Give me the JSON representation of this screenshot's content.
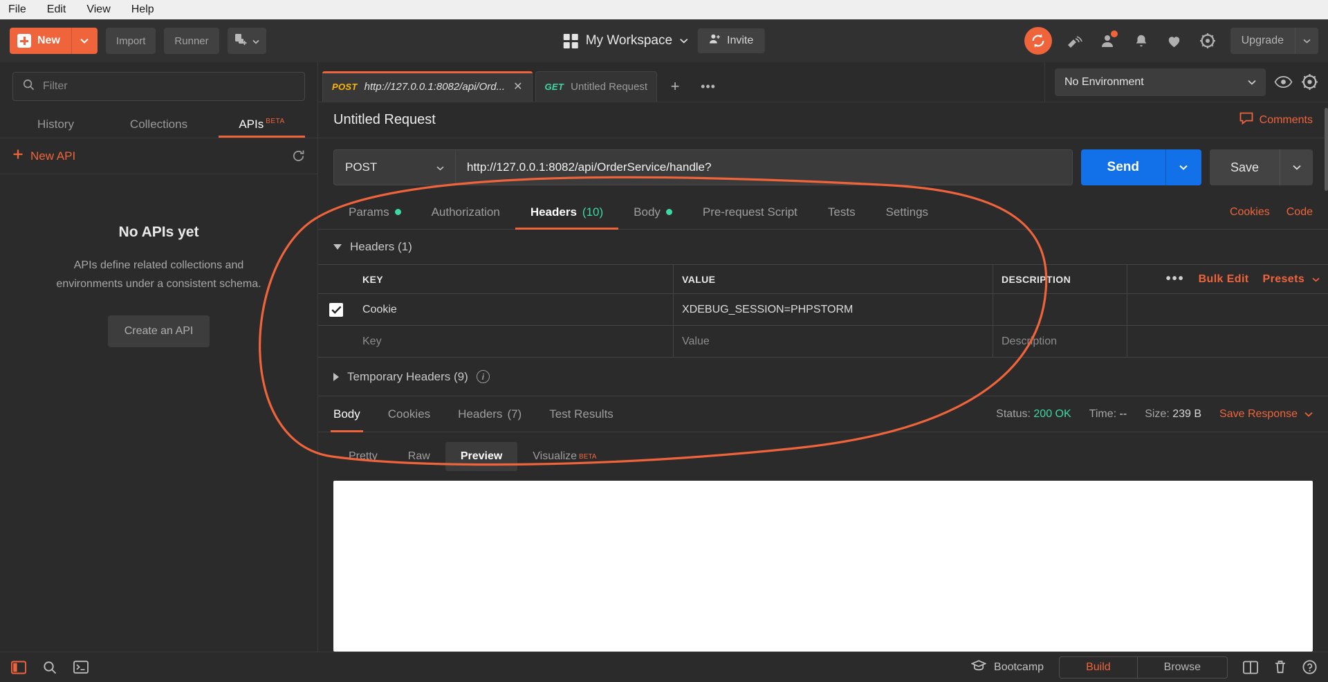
{
  "menubar": {
    "items": [
      "File",
      "Edit",
      "View",
      "Help"
    ]
  },
  "toolbar": {
    "new_label": "New",
    "import_label": "Import",
    "runner_label": "Runner",
    "workspace_name": "My Workspace",
    "invite_label": "Invite",
    "upgrade_label": "Upgrade",
    "icons": {
      "new_plus": "plus-icon",
      "new_caret": "chevron-down-icon",
      "capture": "capture-requests-icon",
      "workspace_grid": "grid-icon",
      "workspace_caret": "chevron-down-icon",
      "invite": "invite-person-icon",
      "sync": "sync-icon",
      "satellite": "satellite-icon",
      "account": "account-notification-icon",
      "bell": "bell-icon",
      "heart": "heart-icon",
      "settings": "gear-icon",
      "upgrade_caret": "chevron-down-icon"
    }
  },
  "sidebar": {
    "filter_placeholder": "Filter",
    "filter_value": "",
    "tabs": [
      {
        "label": "History",
        "active": false
      },
      {
        "label": "Collections",
        "active": false
      },
      {
        "label": "APIs",
        "active": true,
        "badge": "BETA"
      }
    ],
    "new_api_label": "New API",
    "refresh_icon": "refresh-icon",
    "empty": {
      "title": "No APIs yet",
      "description": "APIs define related collections and environments under a consistent schema.",
      "button_label": "Create an API"
    }
  },
  "request_tabs": [
    {
      "method": "POST",
      "title": "http://127.0.0.1:8082/api/Ord...",
      "active": true,
      "closable": true
    },
    {
      "method": "GET",
      "title": "Untitled Request",
      "active": false,
      "closable": false
    }
  ],
  "tabbar": {
    "add_label": "+",
    "more_label": "•••"
  },
  "environment": {
    "selected": "No Environment",
    "eye_icon": "eye-icon",
    "gear_icon": "gear-icon"
  },
  "request": {
    "title": "Untitled Request",
    "comments_label": "Comments",
    "method": "POST",
    "url": "http://127.0.0.1:8082/api/OrderService/handle?",
    "send_label": "Send",
    "save_label": "Save",
    "tabs": [
      {
        "label": "Params",
        "dot": true,
        "active": false
      },
      {
        "label": "Authorization",
        "dot": false,
        "active": false
      },
      {
        "label": "Headers",
        "count": "(10)",
        "active": true
      },
      {
        "label": "Body",
        "dot": true,
        "active": false
      },
      {
        "label": "Pre-request Script",
        "active": false
      },
      {
        "label": "Tests",
        "active": false
      },
      {
        "label": "Settings",
        "active": false
      }
    ],
    "links": [
      {
        "label": "Cookies"
      },
      {
        "label": "Code"
      }
    ]
  },
  "headers_section": {
    "title": "Headers (1)",
    "columns": [
      "KEY",
      "VALUE",
      "DESCRIPTION"
    ],
    "dots_label": "•••",
    "bulk_edit_label": "Bulk Edit",
    "presets_label": "Presets",
    "rows": [
      {
        "checked": true,
        "key": "Cookie",
        "value": "XDEBUG_SESSION=PHPSTORM",
        "description": ""
      }
    ],
    "placeholder_row": {
      "key": "Key",
      "value": "Value",
      "description": "Description"
    },
    "temporary_headers_label": "Temporary Headers (9)"
  },
  "response": {
    "tabs": [
      {
        "label": "Body",
        "active": true
      },
      {
        "label": "Cookies",
        "active": false
      },
      {
        "label": "Headers",
        "count": "(7)",
        "active": false
      },
      {
        "label": "Test Results",
        "active": false
      }
    ],
    "status_label": "Status:",
    "status_value": "200 OK",
    "time_label": "Time:",
    "time_value": "--",
    "size_label": "Size:",
    "size_value": "239 B",
    "save_response_label": "Save Response",
    "formats": [
      {
        "label": "Pretty",
        "active": false
      },
      {
        "label": "Raw",
        "active": false
      },
      {
        "label": "Preview",
        "active": true
      },
      {
        "label": "Visualize",
        "badge": "BETA",
        "active": false
      }
    ],
    "body_content": ""
  },
  "statusbar": {
    "icons": {
      "sidebar": "sidebar-toggle-icon",
      "search": "search-icon",
      "console": "console-icon",
      "layout": "two-pane-layout-icon",
      "trash": "trash-icon",
      "help": "help-circle-icon"
    },
    "bootcamp_label": "Bootcamp",
    "build_label": "Build",
    "browse_label": "Browse"
  },
  "colors": {
    "accent": "#f0643c",
    "send_blue": "#1271e8",
    "green": "#3dd9a5",
    "post_yellow": "#ffb800"
  }
}
